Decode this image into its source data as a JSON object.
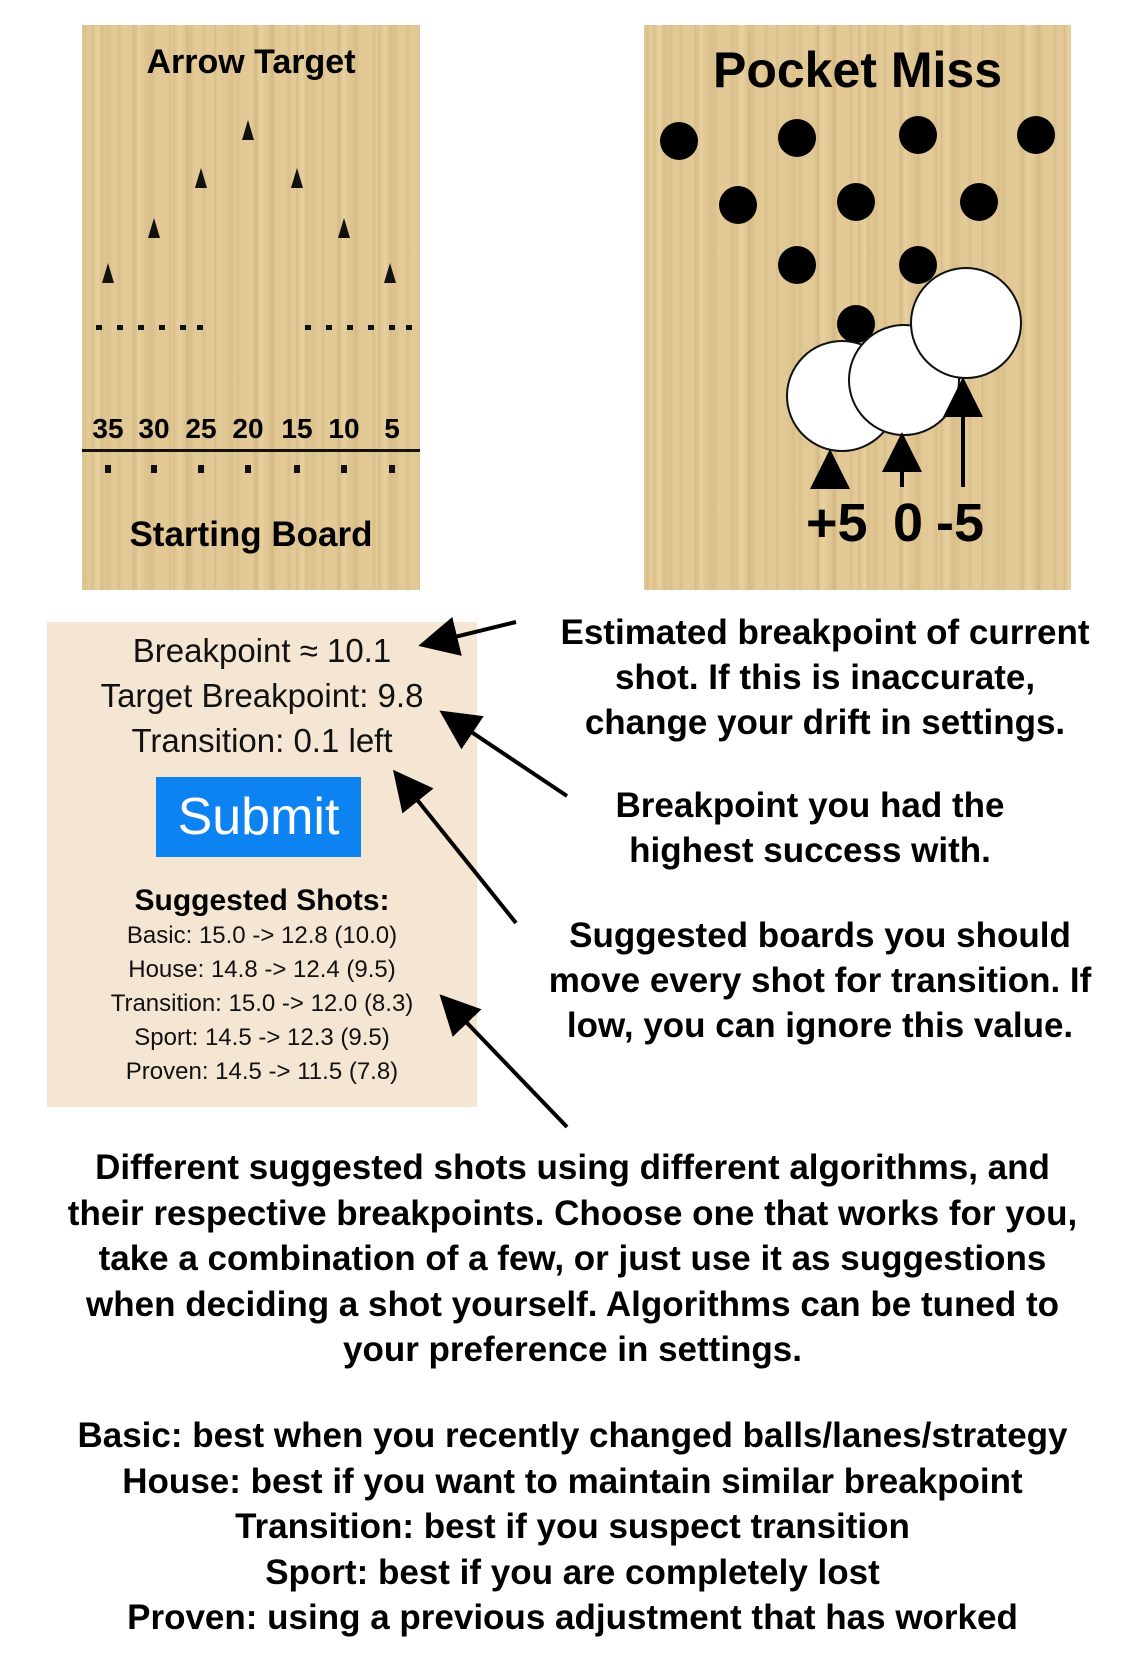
{
  "arrow_target": {
    "title": "Arrow Target",
    "board_numbers": [
      "35",
      "30",
      "25",
      "20",
      "15",
      "10",
      "5"
    ],
    "footer": "Starting Board"
  },
  "pocket_miss": {
    "title": "Pocket Miss",
    "miss_labels": [
      "+5",
      "0",
      "-5"
    ]
  },
  "stats": {
    "breakpoint": "Breakpoint ≈ 10.1",
    "target_breakpoint": "Target Breakpoint: 9.8",
    "transition": "Transition: 0.1 left",
    "submit_label": "Submit",
    "suggested_heading": "Suggested Shots:",
    "suggested_shots": [
      "Basic: 15.0 -> 12.8 (10.0)",
      "House: 14.8 -> 12.4 (9.5)",
      "Transition: 15.0 -> 12.0 (8.3)",
      "Sport: 14.5 -> 12.3 (9.5)",
      "Proven: 14.5 -> 11.5 (7.8)"
    ]
  },
  "annotations": {
    "breakpoint_note": [
      "Estimated breakpoint of current",
      "shot. If this is inaccurate,",
      "change your drift in settings."
    ],
    "target_note": [
      "Breakpoint you had the",
      "highest success with."
    ],
    "transition_note": [
      "Suggested boards you should",
      "move every shot for transition. If",
      "low, you can ignore this value."
    ],
    "suggested_note": [
      "Different suggested shots using different algorithms, and",
      "their respective breakpoints. Choose one that works for you,",
      "take a combination of a few, or just use it as suggestions",
      "when deciding a shot yourself. Algorithms can be tuned to",
      "your preference in settings."
    ],
    "algorithm_notes": [
      "Basic: best when you recently changed balls/lanes/strategy",
      "House: best if you want to maintain similar breakpoint",
      "Transition: best if you suspect transition",
      "Sport: best if you are completely lost",
      "Proven: using a previous adjustment that has worked"
    ]
  }
}
